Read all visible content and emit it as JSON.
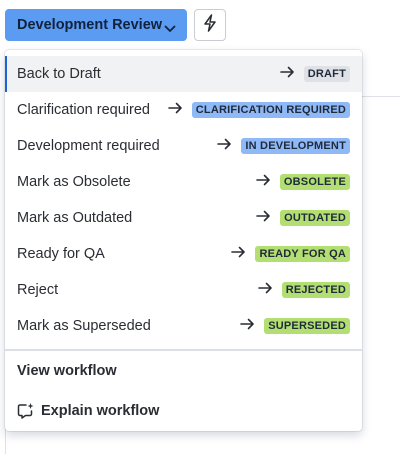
{
  "status_button": {
    "label": "Development Review",
    "color": "#5b9bf2"
  },
  "menu": {
    "transitions": [
      {
        "label": "Back to Draft",
        "target": "DRAFT",
        "color": "#dfe1e6",
        "selected": true
      },
      {
        "label": "Clarification required",
        "target": "CLARIFICATION REQUIRED",
        "color": "#8fb8f6",
        "selected": false
      },
      {
        "label": "Development required",
        "target": "IN DEVELOPMENT",
        "color": "#8fb8f6",
        "selected": false
      },
      {
        "label": "Mark as Obsolete",
        "target": "OBSOLETE",
        "color": "#b3df72",
        "selected": false
      },
      {
        "label": "Mark as Outdated",
        "target": "OUTDATED",
        "color": "#b3df72",
        "selected": false
      },
      {
        "label": "Ready for QA",
        "target": "READY FOR QA",
        "color": "#b3df72",
        "selected": false
      },
      {
        "label": "Reject",
        "target": "REJECTED",
        "color": "#b3df72",
        "selected": false
      },
      {
        "label": "Mark as Superseded",
        "target": "SUPERSEDED",
        "color": "#b3df72",
        "selected": false
      }
    ],
    "view_workflow": "View workflow",
    "explain_workflow": "Explain workflow"
  },
  "icons": {
    "status_chevron": "chevron-down-icon",
    "automation": "lightning-bolt-icon",
    "transition_arrow": "arrow-right-icon",
    "explain": "ai-sparkle-comment-icon"
  }
}
